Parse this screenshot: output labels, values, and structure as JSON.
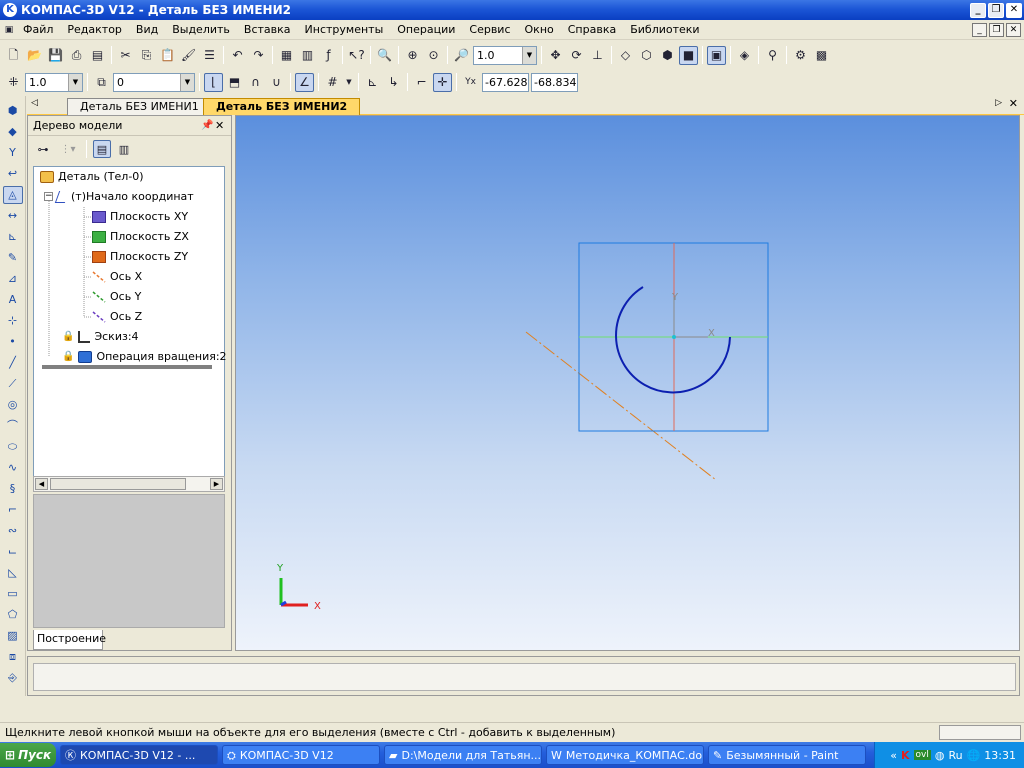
{
  "window": {
    "title": "КОМПАС-3D V12 - Деталь БЕЗ ИМЕНИ2"
  },
  "menu": [
    "Файл",
    "Редактор",
    "Вид",
    "Выделить",
    "Вставка",
    "Инструменты",
    "Операции",
    "Сервис",
    "Окно",
    "Справка",
    "Библиотеки"
  ],
  "toolbar1": {
    "zoom_value": "1.0"
  },
  "toolbar2": {
    "step_value": "1.0",
    "layer_value": "0",
    "coord_x": "-67.628",
    "coord_y": "-68.834"
  },
  "tabs": [
    "Деталь БЕЗ ИМЕНИ1",
    "Деталь БЕЗ ИМЕНИ2"
  ],
  "tree": {
    "title": "Дерево модели",
    "footer_tab": "Построение",
    "nodes": [
      {
        "label": "Деталь (Тел-0)",
        "icon": "part-icon"
      },
      {
        "label": "(т)Начало координат",
        "icon": "origin-icon"
      },
      {
        "label": "Плоскость XY",
        "icon": "plane-xy-icon",
        "color": "#6a5acd"
      },
      {
        "label": "Плоскость ZX",
        "icon": "plane-zx-icon",
        "color": "#3cb043"
      },
      {
        "label": "Плоскость ZY",
        "icon": "plane-zy-icon",
        "color": "#e06a1a"
      },
      {
        "label": "Ось X",
        "icon": "axis-x-icon",
        "color": "#e87830"
      },
      {
        "label": "Ось Y",
        "icon": "axis-y-icon",
        "color": "#2d9a2d"
      },
      {
        "label": "Ось Z",
        "icon": "axis-z-icon",
        "color": "#6a3cc0"
      },
      {
        "label": "Эскиз:4",
        "icon": "sketch-icon"
      },
      {
        "label": "Операция вращения:2",
        "icon": "revolve-icon"
      }
    ]
  },
  "viewport": {
    "sketch_axis_x": "X",
    "sketch_axis_y": "Y",
    "triad_x": "X",
    "triad_y": "Y",
    "colors": {
      "sketch_frame": "#1e7be0",
      "arc": "#0c1fb0",
      "horizontal_axis": "#6fe06f",
      "vertical_axis": "#e06a5a",
      "rotation_axis": "#e08020"
    }
  },
  "status": {
    "hint": "Щелкните левой кнопкой мыши на объекте для его выделения (вместе с Ctrl - добавить к выделенным)"
  },
  "taskbar": {
    "start": "Пуск",
    "tasks": [
      "КОМПАС-3D V12 - ...",
      "КОМПАС-3D V12",
      "D:\\Модели для Татьян...",
      "Методичка_КОМПАС.do...",
      "Безымянный - Paint"
    ],
    "clock": "13:31",
    "lang": "Ru"
  }
}
